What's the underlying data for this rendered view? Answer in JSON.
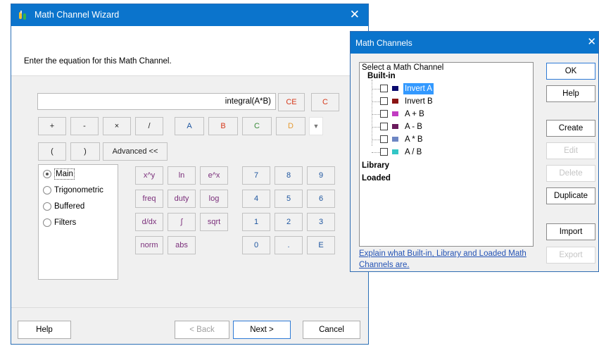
{
  "wizard": {
    "title": "Math Channel Wizard",
    "close_glyph": "✕",
    "prompt": "Enter the equation for this Math Channel.",
    "equation_value": "integral(A*B)",
    "clear_entry_label": "CE",
    "clear_label": "C",
    "operators": [
      "+",
      "-",
      "×",
      "/"
    ],
    "channels": [
      "A",
      "B",
      "C",
      "D"
    ],
    "dropdown_glyph": "▼",
    "paren_open": "(",
    "paren_close": ")",
    "advanced_label": "Advanced <<",
    "categories": [
      "Main",
      "Trigonometric",
      "Buffered",
      "Filters"
    ],
    "selected_category": "Main",
    "functions": {
      "row1": [
        "x^y",
        "ln",
        "e^x"
      ],
      "row2": [
        "freq",
        "duty",
        "log"
      ],
      "row3": [
        "d/dx",
        "∫",
        "sqrt"
      ],
      "row4": [
        "norm",
        "abs"
      ]
    },
    "keypad": {
      "row1": [
        "7",
        "8",
        "9"
      ],
      "row2": [
        "4",
        "5",
        "6"
      ],
      "row3": [
        "1",
        "2",
        "3"
      ],
      "row4": [
        "0",
        ".",
        "E"
      ]
    },
    "footer": {
      "help": "Help",
      "back": "< Back",
      "next": "Next >",
      "cancel": "Cancel"
    },
    "colors": {
      "titlebar": "#0b74cc",
      "function_text": "#7b2f7b",
      "keypad_text": "#1e56a0",
      "clear_text": "#d63a1c"
    }
  },
  "math_channels": {
    "title": "Math Channels",
    "close_glyph": "✕",
    "caption": "Select a Math Channel",
    "groups": {
      "builtin": "Built-in",
      "library": "Library",
      "loaded": "Loaded"
    },
    "builtin_items": [
      {
        "label": "Invert A",
        "color": "#0a0a6e",
        "selected": true
      },
      {
        "label": "Invert B",
        "color": "#8a1414",
        "selected": false
      },
      {
        "label": "A + B",
        "color": "#c23cc2",
        "selected": false
      },
      {
        "label": "A - B",
        "color": "#6a1a5c",
        "selected": false
      },
      {
        "label": "A * B",
        "color": "#6d86c4",
        "selected": false
      },
      {
        "label": "A / B",
        "color": "#33c6c6",
        "selected": false
      }
    ],
    "buttons": {
      "ok": "OK",
      "help": "Help",
      "create": "Create",
      "edit": "Edit",
      "delete": "Delete",
      "duplicate": "Duplicate",
      "import": "Import",
      "export": "Export"
    },
    "help_link": "Explain what Built-in, Library and Loaded Math Channels are."
  }
}
